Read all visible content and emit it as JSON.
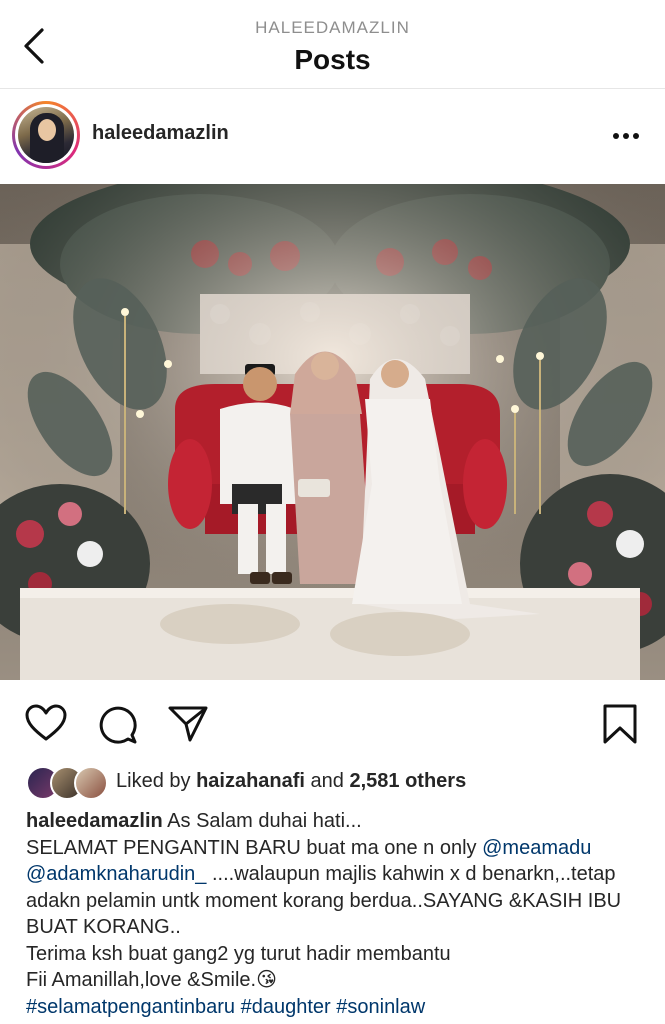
{
  "header": {
    "account": "HALEEDAMAZLIN",
    "title": "Posts"
  },
  "post": {
    "username": "haleedamazlin",
    "image_description_icon": "wedding-photo"
  },
  "likes": {
    "prefix": "Liked by",
    "liker": "haizahanafi",
    "and": "and",
    "count": "2,581 others"
  },
  "caption": {
    "username": "haleedamazlin",
    "line1": "As Salam duhai hati...",
    "p2_text1": "SELAMAT PENGANTIN BARU buat ma one n only",
    "mention1": "@meamadu",
    "mention2": "@adamknaharudin_",
    "p2_text2": "....walaupun majlis kahwin x d benarkn,..tetap adakn pelamin untk moment korang berdua..SAYANG &KASIH IBU BUAT KORANG..",
    "p3": "Terima ksh buat gang2 yg turut hadir membantu",
    "p4": "Fii Amanillah,love &Smile.",
    "emoji": "😘",
    "tag1": "#selamatpengantinbaru",
    "tag2": "#daughter",
    "tag3": "#soninlaw"
  },
  "colors": {
    "link": "#00376b",
    "text": "#262626",
    "muted": "#8e8e8e"
  }
}
